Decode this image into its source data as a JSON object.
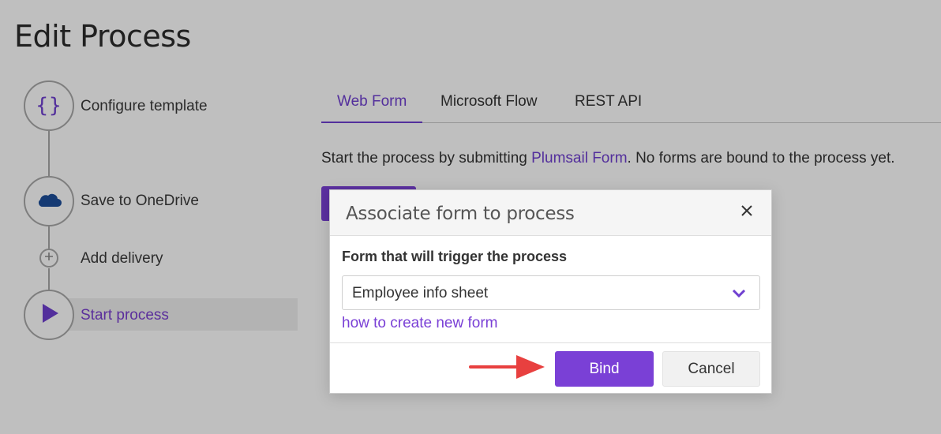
{
  "page": {
    "title": "Edit Process"
  },
  "steps": [
    {
      "label": "Configure template",
      "icon": "braces-icon"
    },
    {
      "label": "Save to OneDrive",
      "icon": "onedrive-cloud-icon"
    },
    {
      "label": "Add delivery",
      "icon": "plus-circle-icon"
    },
    {
      "label": "Start process",
      "icon": "play-icon",
      "active": true
    }
  ],
  "tabs": [
    {
      "label": "Web Form",
      "active": true
    },
    {
      "label": "Microsoft Flow"
    },
    {
      "label": "REST API"
    }
  ],
  "description": {
    "before": "Start the process by submitting ",
    "link": "Plumsail Form",
    "after": ". No forms are bound to the process yet."
  },
  "modal": {
    "title": "Associate form to process",
    "field_label": "Form that will trigger the process",
    "select_value": "Employee info sheet",
    "help_link": "how to create new form",
    "bind_label": "Bind",
    "cancel_label": "Cancel"
  },
  "colors": {
    "accent": "#7a40d6",
    "arrow": "#e8403f",
    "onedrive": "#1c4e9a"
  }
}
